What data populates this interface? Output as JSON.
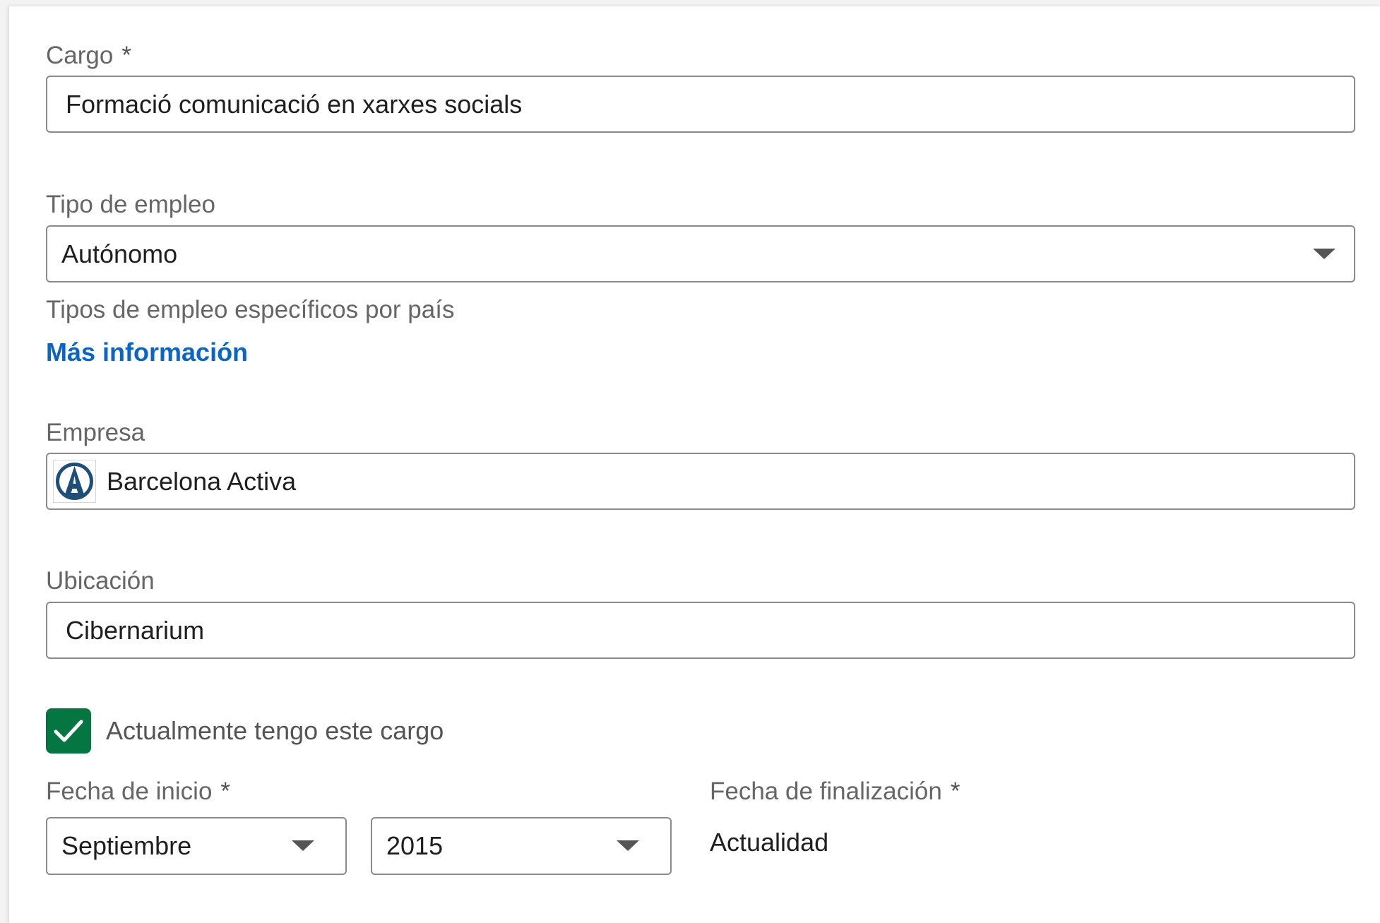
{
  "form": {
    "cargo": {
      "label": "Cargo",
      "required_mark": "*",
      "value": "Formació comunicació en xarxes socials"
    },
    "tipo_empleo": {
      "label": "Tipo de empleo",
      "value": "Autónomo",
      "helper": "Tipos de empleo específicos por país",
      "link": "Más información"
    },
    "empresa": {
      "label": "Empresa",
      "value": "Barcelona Activa",
      "logo_icon": "barcelona-activa-logo"
    },
    "ubicacion": {
      "label": "Ubicación",
      "value": "Cibernarium"
    },
    "current_role": {
      "label": "Actualmente tengo este cargo",
      "checked": true
    },
    "fecha_inicio": {
      "label": "Fecha de inicio",
      "required_mark": "*",
      "month": "Septiembre",
      "year": "2015"
    },
    "fecha_fin": {
      "label": "Fecha de finalización",
      "required_mark": "*",
      "value": "Actualidad"
    }
  },
  "colors": {
    "accent_link": "#0a66c2",
    "checkbox_green": "#057642",
    "field_border": "#8a8a8a",
    "label_gray": "#666666"
  }
}
